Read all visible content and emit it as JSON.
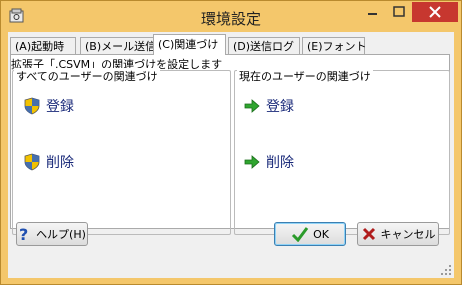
{
  "window": {
    "title": "環境設定"
  },
  "tabs": [
    {
      "label": "(A)起動時"
    },
    {
      "label": "(B)メール送信"
    },
    {
      "label": "(C)関連づけ"
    },
    {
      "label": "(D)送信ログ"
    },
    {
      "label": "(E)フォント"
    }
  ],
  "panel": {
    "description": "拡張子「.CSVM」の関連づけを設定します",
    "all_users": {
      "title": "すべてのユーザーの関連づけ",
      "register": "登録",
      "delete": "削除"
    },
    "current_user": {
      "title": "現在のユーザーの関連づけ",
      "register": "登録",
      "delete": "削除"
    }
  },
  "buttons": {
    "help": "ヘルプ(H)",
    "ok": "OK",
    "cancel": "キャンセル"
  },
  "colors": {
    "frame": "#f4c76b",
    "close": "#c7372f",
    "link": "#1a2a7a"
  }
}
